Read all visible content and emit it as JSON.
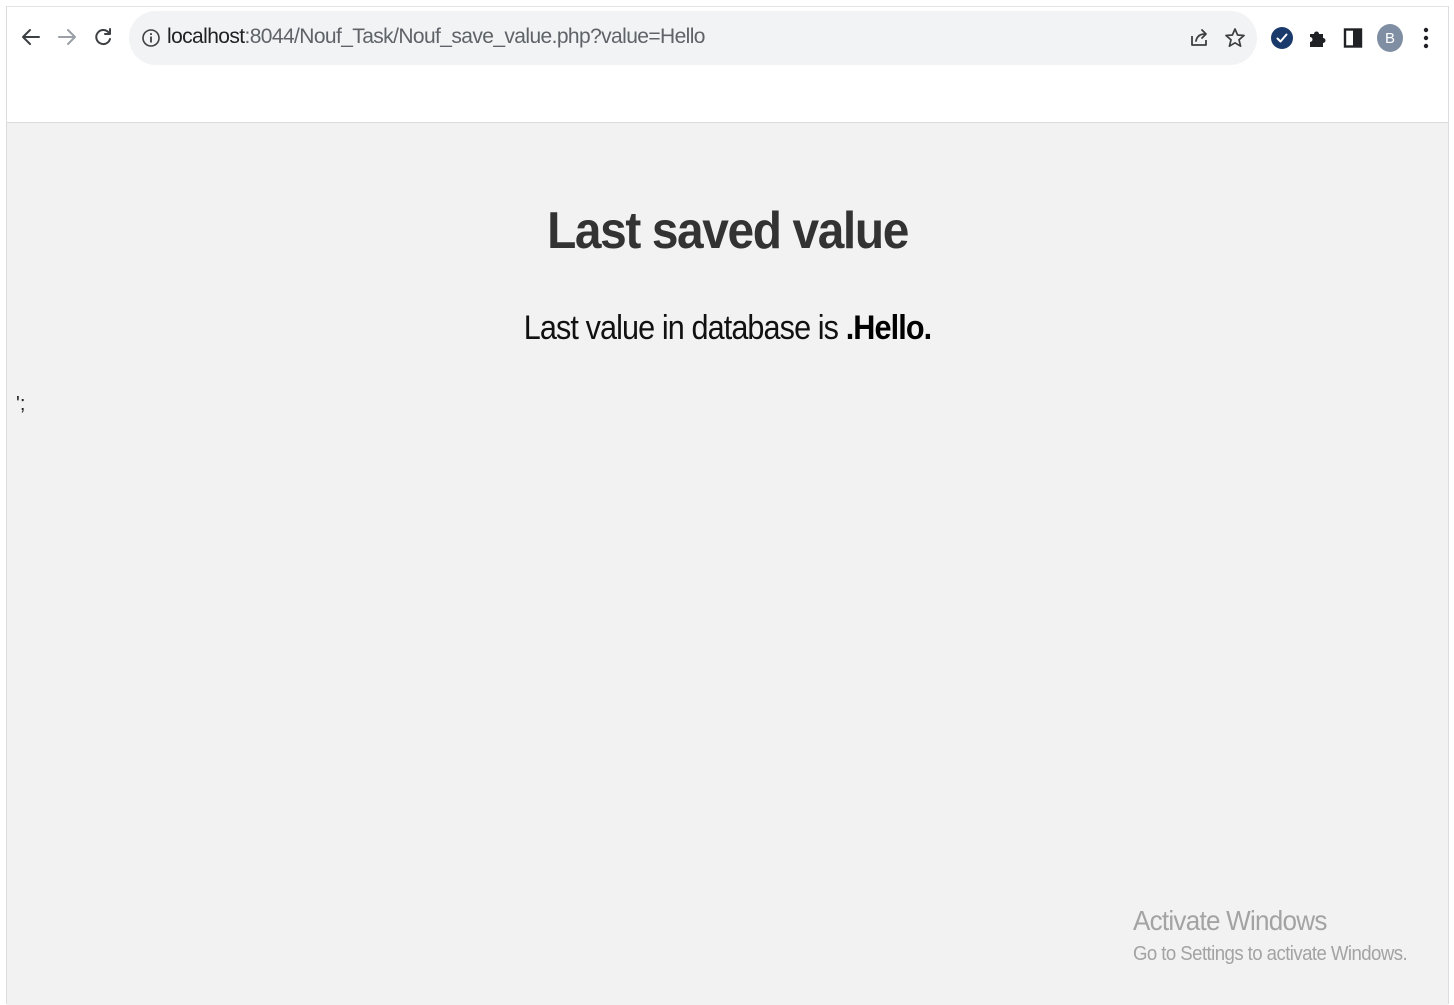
{
  "browser": {
    "url_host": "localhost",
    "url_rest": ":8044/Nouf_Task/Nouf_save_value.php?value=Hello",
    "profile_initial": "B",
    "icons": {
      "back": "arrow-left-icon",
      "forward": "arrow-right-icon",
      "reload": "reload-icon",
      "site_info": "info-icon",
      "share": "share-icon",
      "bookmark": "star-icon",
      "extension_check": "check-circle-icon",
      "extensions": "puzzle-icon",
      "side_panel": "side-panel-icon",
      "menu": "kebab-menu-icon"
    },
    "colors": {
      "omnibox_bg": "#f1f3f4",
      "avatar_bg": "#7f8ea3",
      "extension_check_bg": "#1a3a6b"
    }
  },
  "page": {
    "title": "Last saved value",
    "message_prefix": "Last value in database is ",
    "message_value": ".Hello.",
    "stray_text": "';",
    "background": "#f2f2f2"
  },
  "watermark": {
    "title": "Activate Windows",
    "subtitle": "Go to Settings to activate Windows."
  }
}
